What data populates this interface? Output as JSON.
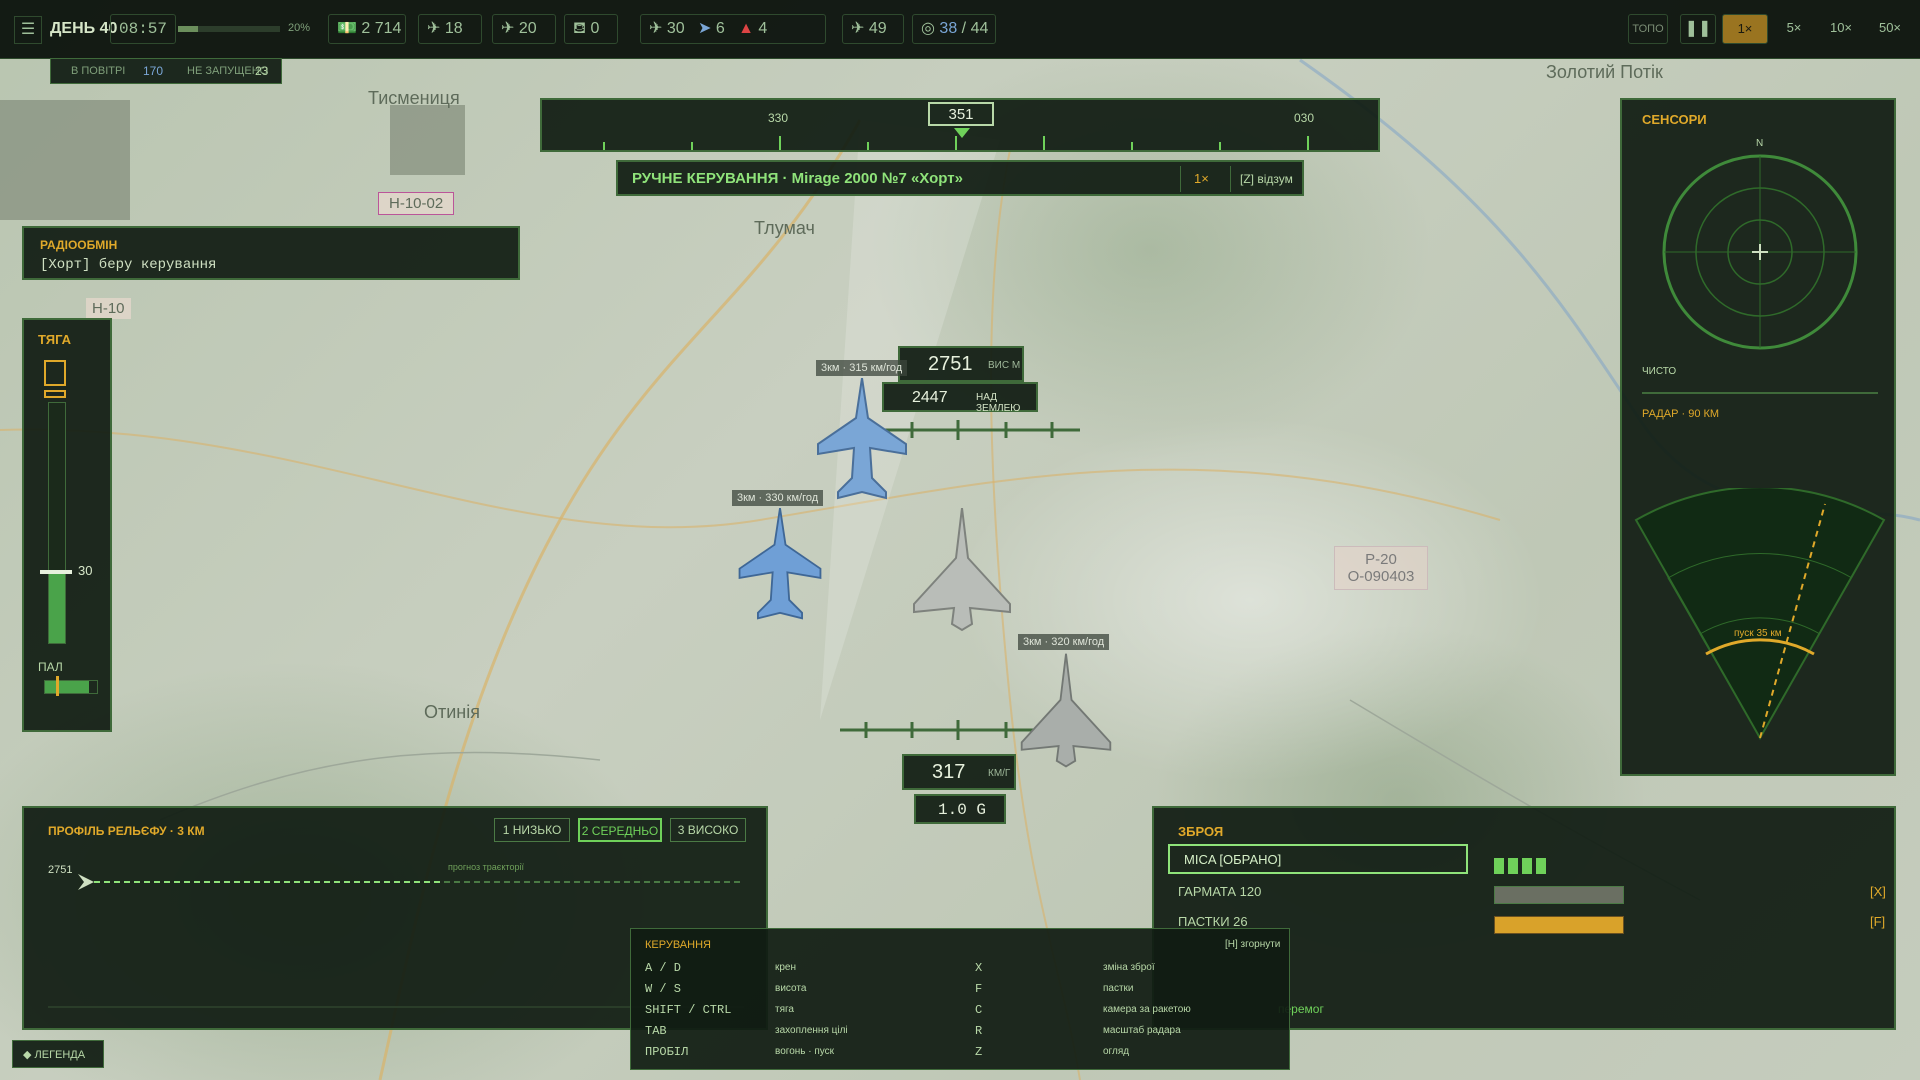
{
  "topbar": {
    "menu_icon": "hamburger-icon",
    "day": "ДЕНЬ 40",
    "time": "08:57",
    "progress_label": "20%",
    "progress_fraction": 0.2,
    "money": "2 714",
    "aircraft_a": "18",
    "aircraft_b": "20",
    "helicopters": "0",
    "jets": "30",
    "missiles": "6",
    "rockets": "4",
    "air_units": "49",
    "targets_current": "38",
    "targets_sep": "/",
    "targets_total": "44",
    "topo": "ТОПО",
    "pause": "❚❚",
    "speeds": [
      "1×",
      "5×",
      "10×",
      "50×"
    ]
  },
  "substatus": {
    "in_air_label": "В ПОВІТРІ",
    "in_air_value": "170",
    "not_launched_label": "НЕ ЗАПУЩЕНО",
    "not_launched_value": "23"
  },
  "map_labels": {
    "tysmenytsia": "Тисмениця",
    "tlumach": "Тлумач",
    "otyniia": "Отинія",
    "zolotyi_potik": "Золотий Потік",
    "h1002": "Н-10-02",
    "h10": "Н-10",
    "p20_a": "Р-20",
    "p20_b": "О-090403"
  },
  "radio": {
    "title": "РАДІООБМІН",
    "message": "[Хорт] беру керування"
  },
  "thrust": {
    "title": "ТЯГА",
    "value": "30",
    "level": 0.3,
    "fuel_label": "ПАЛ",
    "fuel_level": 0.85
  },
  "heading": {
    "left_tick": "330",
    "current": "351",
    "right_tick": "030"
  },
  "manual": {
    "title": "РУЧНЕ КЕРУВАННЯ · Mirage 2000 №7 «Хорт»",
    "speed": "1×",
    "hint": "[Z] відзум"
  },
  "altitude": {
    "value": "2751",
    "unit": "ВИС М",
    "ground_value": "2447",
    "ground_unit": "НАД ЗЕМЛЕЮ"
  },
  "speed": {
    "value": "317",
    "unit": "КМ/Г",
    "g": "1.0 G"
  },
  "aircraft_tags": {
    "a": "3км · 315 км/год",
    "b": "3км · 330 км/год",
    "c": "3км · 320 км/год"
  },
  "sensors": {
    "title": "СЕНСОРИ",
    "north": "N",
    "status": "ЧИСТО",
    "radar_label": "РАДАР · 90 КМ",
    "launch_label": "пуск 35 км"
  },
  "terrain": {
    "title": "ПРОФІЛЬ РЕЛЬЄФУ · 3 КМ",
    "buttons": [
      "1 НИЗЬКО",
      "2 СЕРЕДНЬО",
      "3 ВИСОКО"
    ],
    "active_index": 1,
    "alt_label": "2751",
    "forecast_label": "прогноз траєкторії"
  },
  "weapons": {
    "title": "ЗБРОЯ",
    "items": [
      {
        "name": "MICA  [ОБРАНО]",
        "key": ""
      },
      {
        "name": "ГАРМАТА 120",
        "key": "[X]"
      },
      {
        "name": "ПАСТКИ 26",
        "key": "[F]"
      }
    ],
    "victory_text": "перемог"
  },
  "controls": {
    "title": "КЕРУВАННЯ",
    "collapse_hint": "[H] згорнути",
    "rows": [
      {
        "key": "A / D",
        "action": "крен",
        "key2": "X",
        "action2": "зміна зброї"
      },
      {
        "key": "W / S",
        "action": "висота",
        "key2": "F",
        "action2": "пастки"
      },
      {
        "key": "SHIFT / CTRL",
        "action": "тяга",
        "key2": "C",
        "action2": "камера за ракетою"
      },
      {
        "key": "TAB",
        "action": "захоплення цілі",
        "key2": "R",
        "action2": "масштаб радара"
      },
      {
        "key": "ПРОБІЛ",
        "action": "вогонь · пуск",
        "key2": "Z",
        "action2": "огляд"
      }
    ]
  },
  "legend": {
    "label": "◆ ЛЕГЕНДА"
  },
  "colors": {
    "panel_bg": "#101c12",
    "accent_green": "#6fd15a",
    "accent_amber": "#e0a92a",
    "border": "#3f6a3a"
  }
}
